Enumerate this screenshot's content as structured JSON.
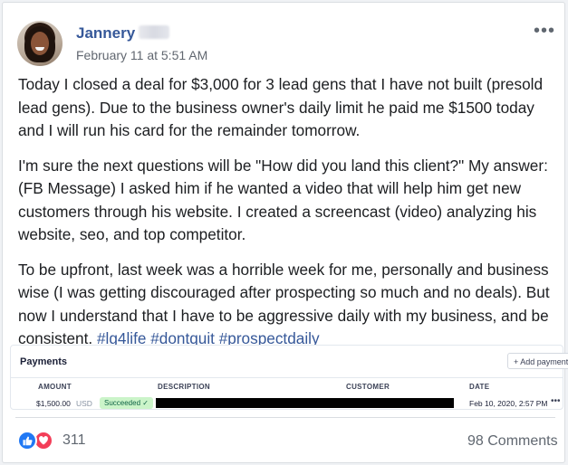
{
  "post": {
    "author": "Jannery",
    "timestamp": "February 11 at 5:51 AM",
    "more_glyph": "•••",
    "paragraphs": [
      "Today I closed a deal for $3,000 for 3 lead gens that I have not built (presold lead gens). Due to the business owner's daily limit he paid me $1500 today and I will run his card for the remainder tomorrow.",
      "I'm sure the next questions will be \"How did you land this client?\" My answer: (FB Message) I asked him if he wanted a video that will help him get new customers through his website. I created a screencast (video) analyzing his website, seo, and top competitor.",
      "To be upfront, last week was a horrible week for me, personally and business wise (I was getting discouraged after prospecting so much and no deals). But now I understand that I have to be aggressive daily with my business, and be consistent."
    ],
    "hashtags": [
      "#lg4life",
      "#dontquit",
      "#prospectdaily"
    ]
  },
  "payments": {
    "title": "Payments",
    "add_label": "+ Add payment",
    "columns": [
      "AMOUNT",
      "DESCRIPTION",
      "CUSTOMER",
      "DATE"
    ],
    "row": {
      "amount": "$1,500.00",
      "currency": "USD",
      "status": "Succeeded ✓",
      "date": "Feb 10, 2020, 2:57 PM",
      "more_glyph": "•••"
    },
    "status_color": "#cbf4c9"
  },
  "footer": {
    "reaction_icons": [
      "like-icon",
      "love-icon"
    ],
    "reaction_count": "311",
    "comments": "98 Comments"
  },
  "colors": {
    "link": "#365899",
    "like": "#2078f4",
    "love": "#f33e58",
    "text": "#1c1e21"
  }
}
